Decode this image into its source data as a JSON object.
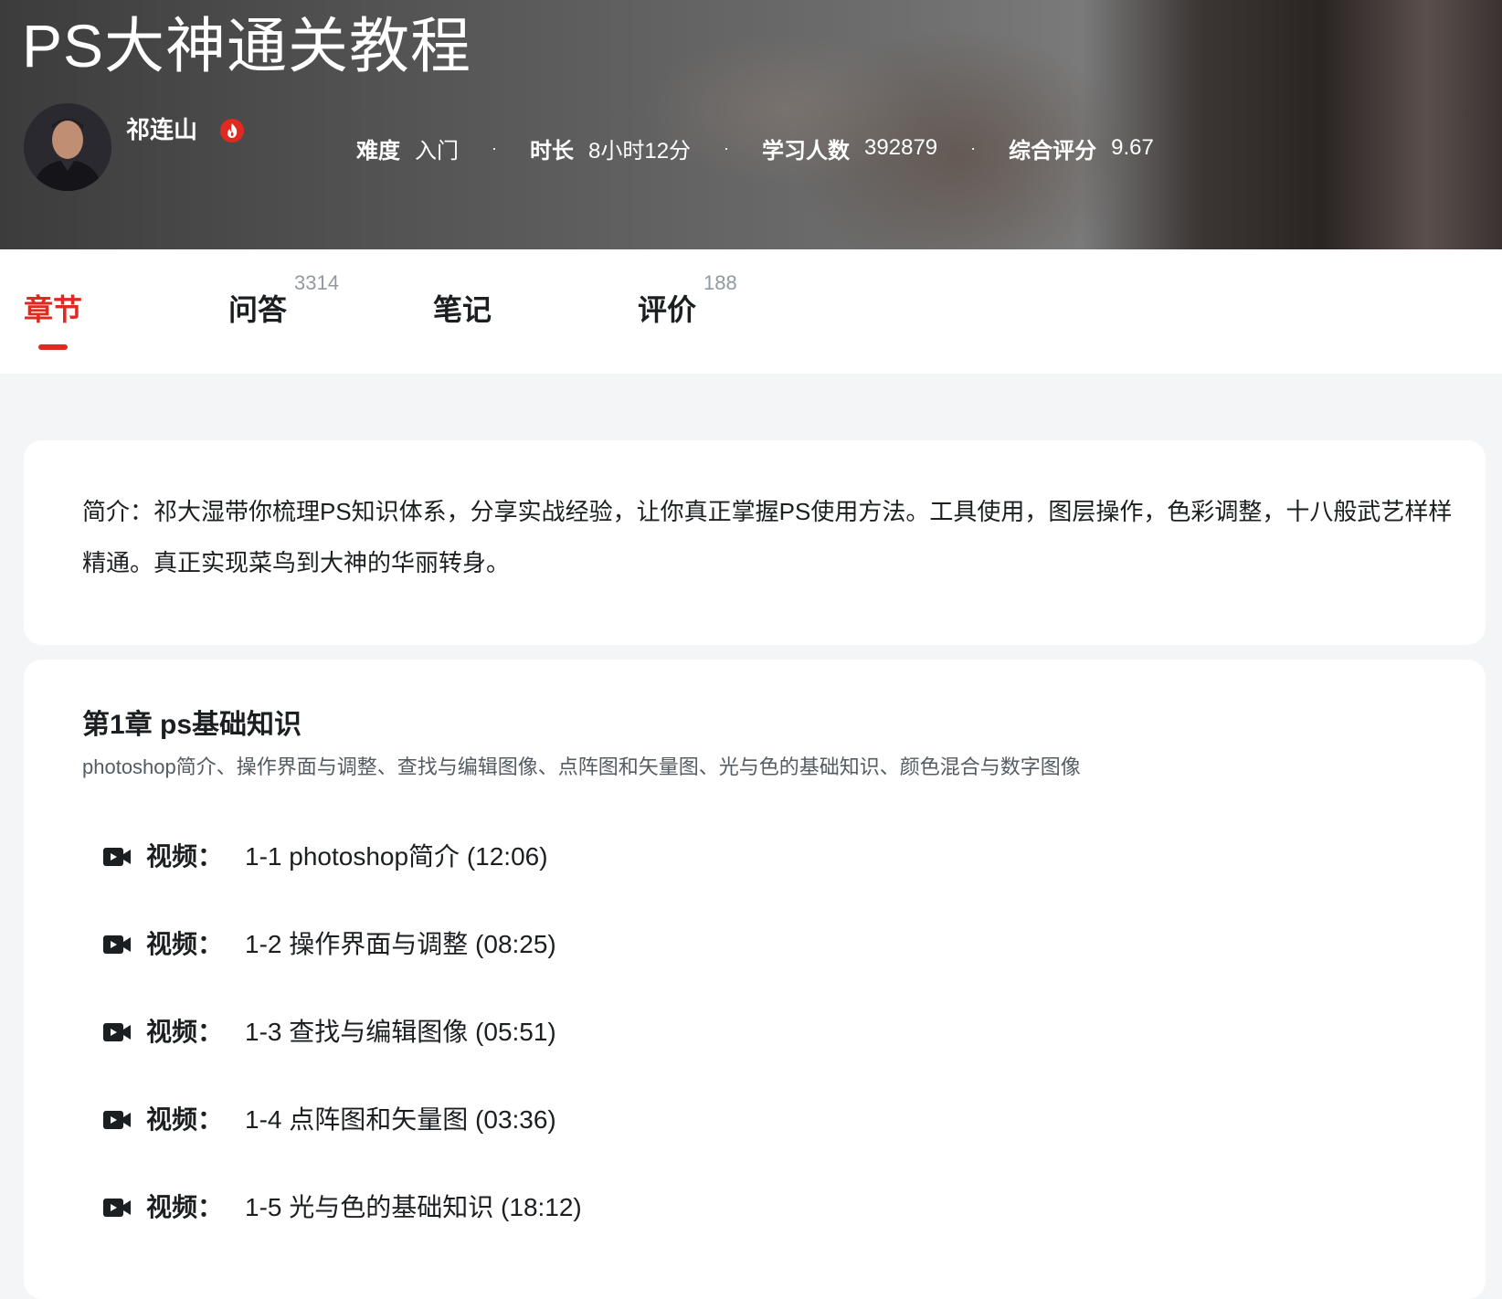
{
  "header": {
    "title": "PS大神通关教程",
    "teacher": {
      "name": "祁连山",
      "avatar_icon": "teacher-avatar",
      "hot_icon": "flame-icon"
    },
    "stats": [
      {
        "label": "难度",
        "value": "入门"
      },
      {
        "label": "时长",
        "value": "8小时12分"
      },
      {
        "label": "学习人数",
        "value": "392879"
      },
      {
        "label": "综合评分",
        "value": "9.67"
      }
    ],
    "separator": "·"
  },
  "tabs": [
    {
      "label": "章节",
      "count": "",
      "active": true
    },
    {
      "label": "问答",
      "count": "3314",
      "active": false
    },
    {
      "label": "笔记",
      "count": "",
      "active": false
    },
    {
      "label": "评价",
      "count": "188",
      "active": false
    }
  ],
  "intro": {
    "text": "简介：祁大湿带你梳理PS知识体系，分享实战经验，让你真正掌握PS使用方法。工具使用，图层操作，色彩调整，十八般武艺样样精通。真正实现菜鸟到大神的华丽转身。"
  },
  "chapter": {
    "title": "第1章 ps基础知识",
    "desc": "photoshop简介、操作界面与调整、查找与编辑图像、点阵图和矢量图、光与色的基础知识、颜色混合与数字图像",
    "lesson_type": "视频：",
    "lessons": [
      {
        "title": "1-1 photoshop简介 (12:06)"
      },
      {
        "title": "1-2 操作界面与调整 (08:25)"
      },
      {
        "title": "1-3 查找与编辑图像 (05:51)"
      },
      {
        "title": "1-4 点阵图和矢量图 (03:36)"
      },
      {
        "title": "1-5 光与色的基础知识 (18:12)"
      }
    ]
  },
  "colors": {
    "accent": "#e02a1f",
    "text": "#1c1f21",
    "muted": "#545c63",
    "count": "#9199a1",
    "bg": "#f3f5f7"
  }
}
